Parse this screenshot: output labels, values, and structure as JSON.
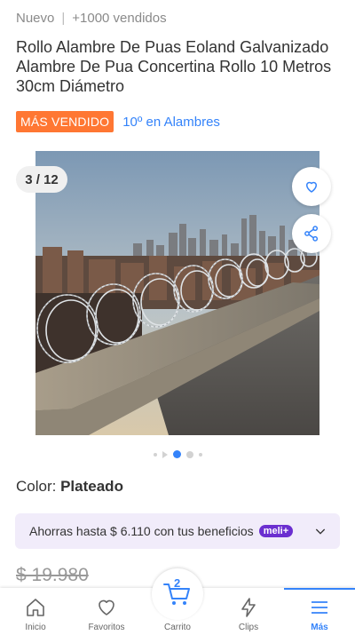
{
  "product": {
    "condition": "Nuevo",
    "separator": "|",
    "sold": "+1000 vendidos",
    "title": "Rollo Alambre De Puas Eoland Galvanizado Alambre De Pua Concertina Rollo 10 Metros 30cm Diámetro",
    "badge": "MÁS VENDIDO",
    "ranking": "10º en Alambres"
  },
  "gallery": {
    "counter": "3 / 12",
    "image_icon": "razor-wire-city-photo",
    "dots_total": 5,
    "dots_active": 3
  },
  "color": {
    "label": "Color:",
    "value": "Plateado"
  },
  "benefits": {
    "text": "Ahorras hasta $ 6.110 con tus beneficios",
    "pill": "meli+"
  },
  "price": {
    "old": "$ 19.980"
  },
  "nav": {
    "items": [
      {
        "label": "Inicio",
        "icon": "home-icon"
      },
      {
        "label": "Favoritos",
        "icon": "heart-icon"
      },
      {
        "label": "Carrito",
        "icon": "cart-icon",
        "count": "2"
      },
      {
        "label": "Clips",
        "icon": "lightning-icon"
      },
      {
        "label": "Más",
        "icon": "menu-icon"
      }
    ]
  },
  "colors": {
    "accent": "#3483fa",
    "badge": "#ff7733",
    "benefit_bg": "#f1ecfa",
    "meli_plus": "#6b2fd0"
  }
}
